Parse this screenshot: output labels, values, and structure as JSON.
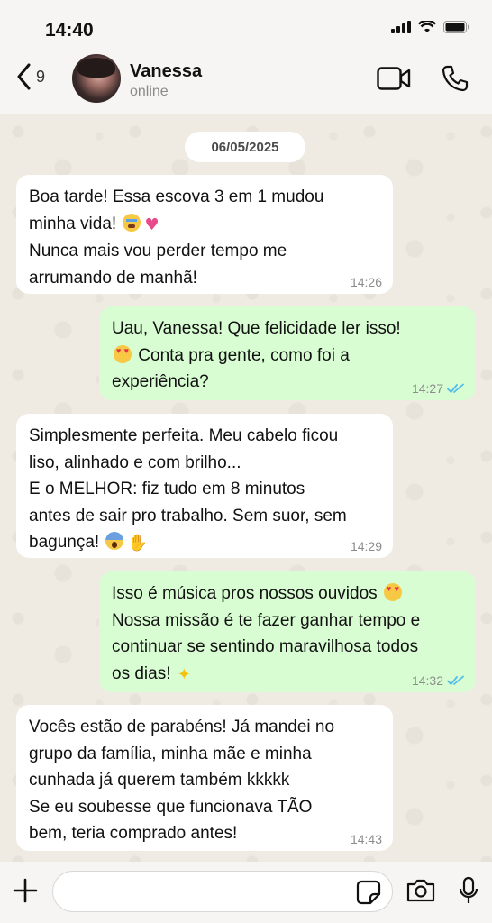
{
  "status_bar": {
    "time": "14:40"
  },
  "header": {
    "back_count": "9",
    "contact_name": "Vanessa",
    "contact_status": "online"
  },
  "chat": {
    "date": "06/05/2025",
    "messages": [
      {
        "direction": "in",
        "lines": [
          "Boa tarde! Essa escova 3 em 1 mudou",
          "minha vida!",
          "Nunca mais vou perder tempo me",
          "arrumando de manhã!"
        ],
        "emojis": [
          "loudly-crying-face",
          "growing-heart"
        ],
        "time": "14:26"
      },
      {
        "direction": "out",
        "lines": [
          "Uau, Vanessa! Que felicidade ler isso!",
          "Conta pra gente, como foi a",
          "experiência?"
        ],
        "emojis": [
          "heart-eyes"
        ],
        "time": "14:27",
        "read": true
      },
      {
        "direction": "in",
        "lines": [
          "Simplesmente perfeita. Meu cabelo ficou",
          "liso, alinhado e com brilho...",
          "E o MELHOR: fiz tudo em 8 minutos",
          "antes de sair pro trabalho. Sem suor, sem",
          "bagunça!"
        ],
        "emojis": [
          "screaming-face",
          "clapping-hands"
        ],
        "time": "14:29"
      },
      {
        "direction": "out",
        "lines": [
          "Isso é música pros nossos ouvidos",
          "Nossa missão é te fazer ganhar tempo e",
          "continuar se sentindo maravilhosa todos",
          "os dias!"
        ],
        "emojis": [
          "heart-eyes",
          "sparkles"
        ],
        "time": "14:32",
        "read": true
      },
      {
        "direction": "in",
        "lines": [
          "Vocês estão de parabéns! Já mandei no",
          "grupo da família, minha mãe e minha",
          "cunhada já querem também kkkkk",
          "Se eu soubesse que funcionava TÃO",
          "bem, teria comprado antes!"
        ],
        "time": "14:43"
      }
    ]
  },
  "colors": {
    "incoming_bubble": "#ffffff",
    "outgoing_bubble": "#d9fdd3",
    "read_ticks": "#53bdeb",
    "chat_background": "#efeae2"
  }
}
